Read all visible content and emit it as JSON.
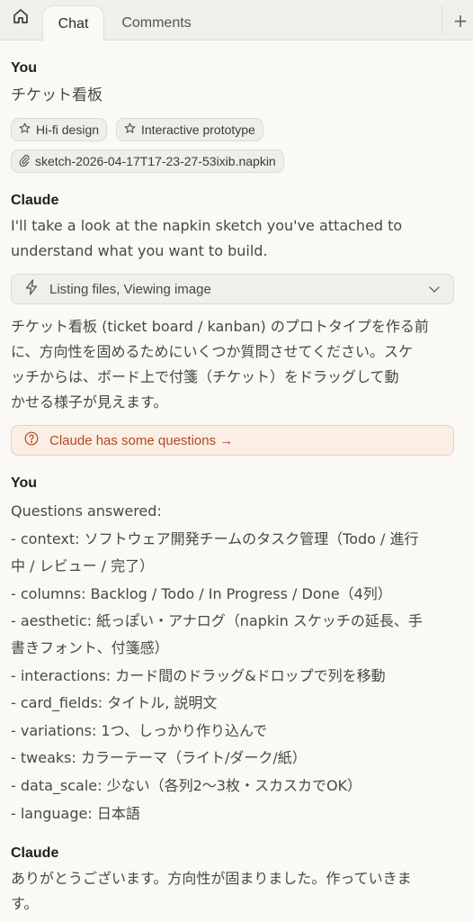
{
  "tabs": {
    "chat": "Chat",
    "comments": "Comments",
    "add": "+"
  },
  "icons": {
    "home": "home-icon",
    "star": "star-icon",
    "paperclip": "paperclip-icon",
    "lightning": "lightning-icon",
    "chevron": "chevron-down-icon",
    "question": "question-circle-icon"
  },
  "messages": {
    "you1": {
      "speaker": "You",
      "text": "チケット看板",
      "chips": [
        "Hi-fi design",
        "Interactive prototype"
      ],
      "attachment": "sketch-2026-04-17T17-23-27-53ixib.napkin"
    },
    "claude1": {
      "speaker": "Claude",
      "intro_lines": [
        "I'll take a look at the napkin sketch you've attached to",
        "understand what you want to build."
      ],
      "tool_label": "Listing files, Viewing image",
      "body_lines": [
        "チケット看板 (ticket board / kanban) のプロトタイプを作る前",
        "に、方向性を固めるためにいくつか質問させてください。スケ",
        "ッチからは、ボード上で付箋（チケット）をドラッグして動",
        "かせる様子が見えます。"
      ],
      "questions_label": "Claude has some questions →"
    },
    "you2": {
      "speaker": "You",
      "lines": [
        "Questions answered:",
        "- context: ソフトウェア開発チームのタスク管理（Todo / 進行",
        "中 / レビュー / 完了）",
        "- columns: Backlog / Todo / In Progress / Done（4列）",
        "- aesthetic: 紙っぽい・アナログ（napkin スケッチの延長、手",
        "書きフォント、付箋感）",
        "- interactions: カード間のドラッグ&ドロップで列を移動",
        "- card_fields: タイトル, 説明文",
        "- variations: 1つ、しっかり作り込んで",
        "- tweaks: カラーテーマ（ライト/ダーク/紙）",
        "- data_scale: 少ない（各列2〜3枚・スカスカでOK）",
        "- language: 日本語"
      ]
    },
    "claude2": {
      "speaker": "Claude",
      "lines": [
        "ありがとうございます。方向性が固まりました。作っていきま",
        "す。"
      ]
    }
  },
  "colors": {
    "background": "#faf9f5",
    "tabbar": "#f0efea",
    "accent": "#b14a1e",
    "questions_bg": "#fbeee4"
  }
}
